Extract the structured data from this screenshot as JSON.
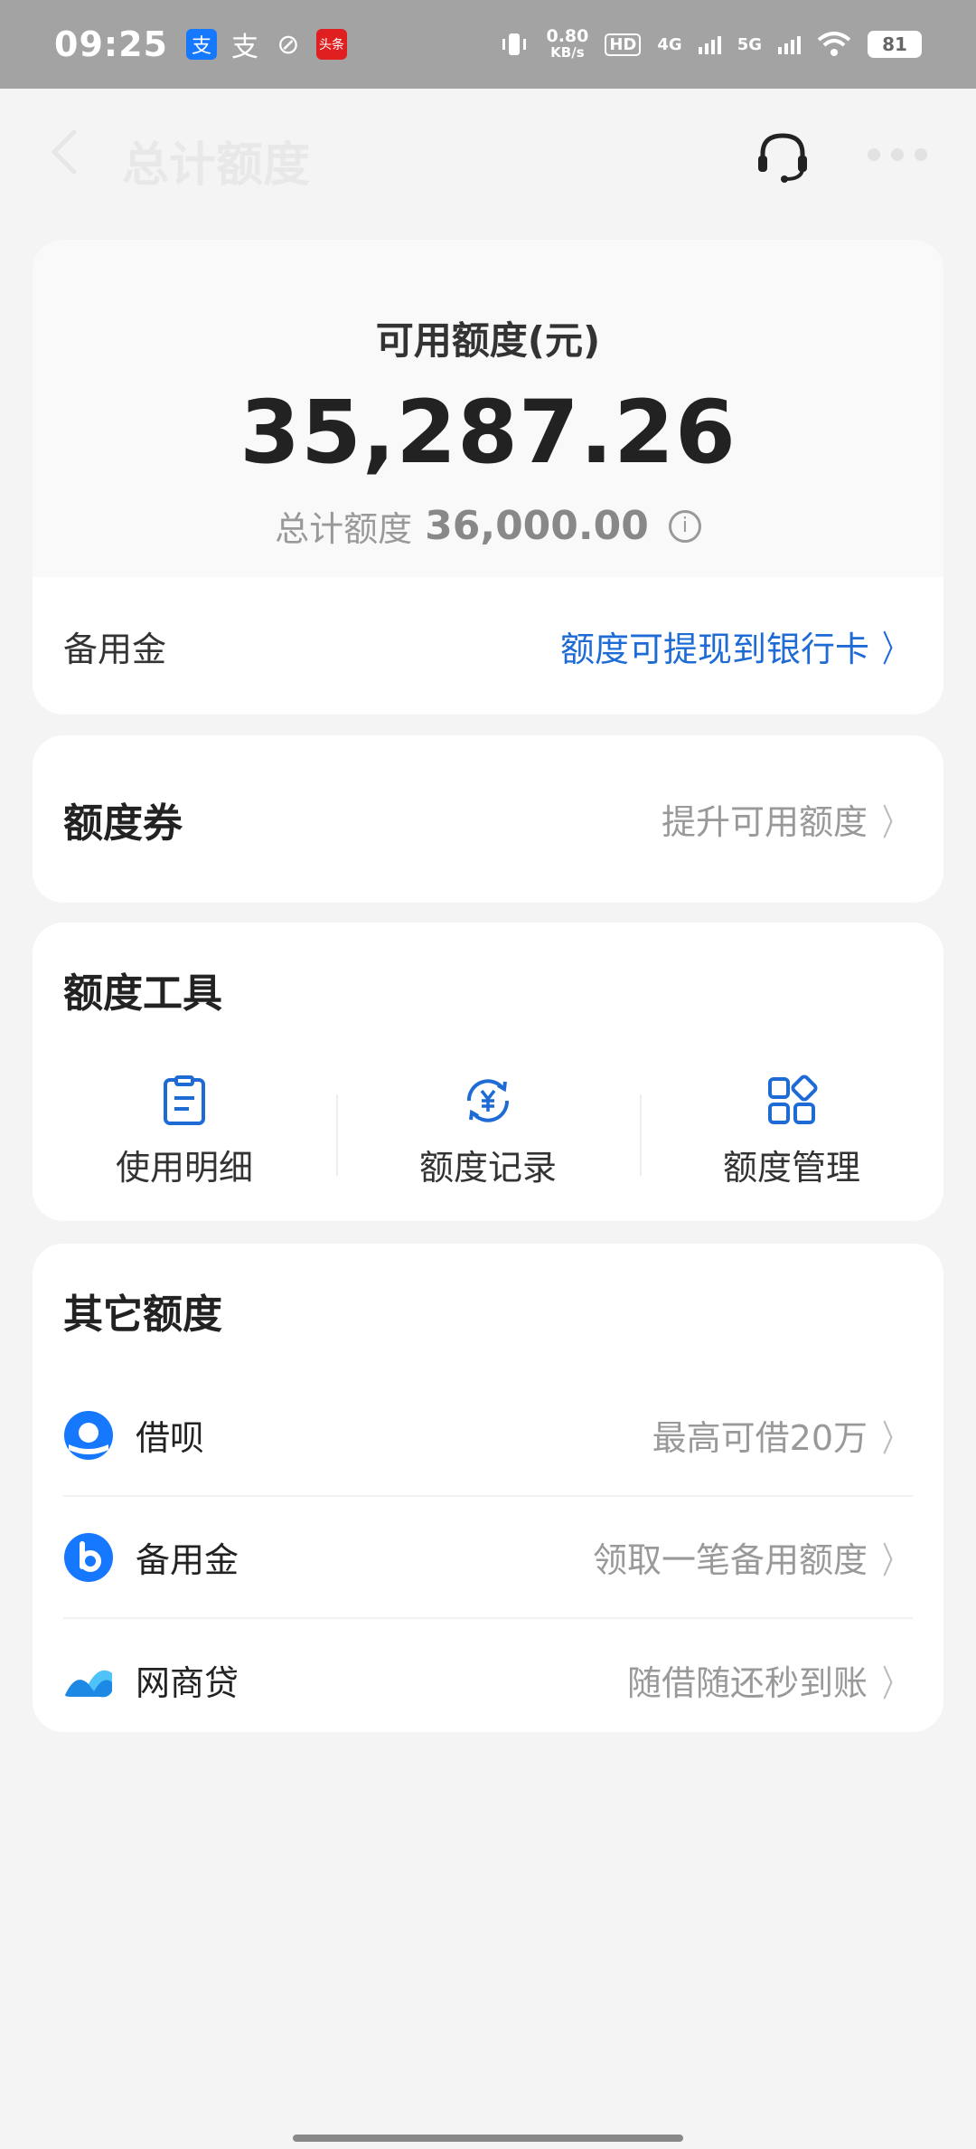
{
  "status_bar": {
    "time": "09:25",
    "speed_value": "0.80",
    "speed_unit": "KB/s",
    "hd_label": "HD",
    "sim1": "4G",
    "sim2": "5G",
    "battery": "81",
    "news_app_label": "头条"
  },
  "header": {
    "title": "总计额度",
    "icons": [
      "back-icon",
      "headset-icon",
      "more-icon"
    ]
  },
  "summary": {
    "available_label": "可用额度(元)",
    "available_value": "35,287.26",
    "total_label": "总计额度",
    "total_value": "36,000.00",
    "info_glyph": "i",
    "reserve_label": "备用金",
    "reserve_link": "额度可提现到银行卡"
  },
  "coupon": {
    "title": "额度券",
    "link": "提升可用额度"
  },
  "tools": {
    "title": "额度工具",
    "items": [
      {
        "label": "使用明细",
        "icon": "list-doc-icon"
      },
      {
        "label": "额度记录",
        "icon": "yuan-refresh-icon"
      },
      {
        "label": "额度管理",
        "icon": "grid-apps-icon"
      }
    ]
  },
  "other": {
    "title": "其它额度",
    "items": [
      {
        "name": "借呗",
        "desc": "最高可借20万",
        "icon": "jiebei-logo-icon"
      },
      {
        "name": "备用金",
        "desc": "领取一笔备用额度",
        "icon": "beiyongjin-logo-icon"
      },
      {
        "name": "网商贷",
        "desc": "随借随还秒到账",
        "icon": "wangshangdai-logo-icon"
      }
    ]
  },
  "colors": {
    "accent_blue": "#1e6bd6",
    "status_bar_bg": "#a3a3a3"
  }
}
